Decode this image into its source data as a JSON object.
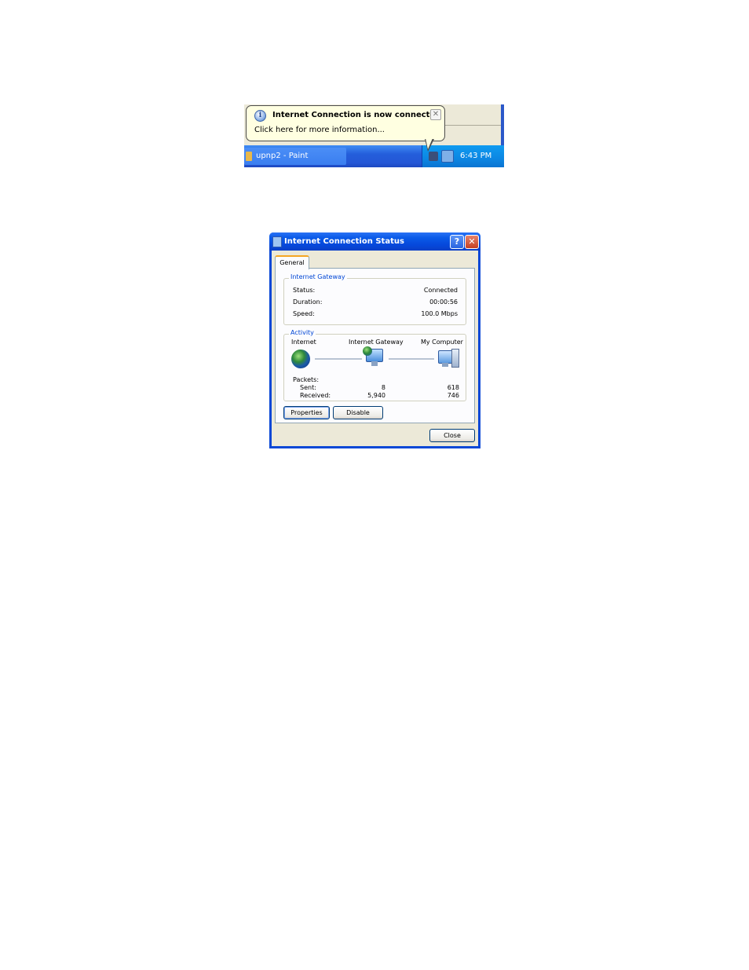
{
  "notification": {
    "title": "Internet Connection is now connected",
    "message": "Click here for more information...",
    "close_glyph": "✕",
    "icon": "info-icon"
  },
  "taskbar": {
    "task_button_label": "upnp2 - Paint",
    "clock": "6:43 PM"
  },
  "dialog": {
    "title": "Internet Connection Status",
    "help_glyph": "?",
    "close_glyph": "✕",
    "tabs": [
      {
        "label": "General"
      }
    ],
    "gateway_group": {
      "legend": "Internet Gateway",
      "rows": [
        {
          "label": "Status:",
          "value": "Connected"
        },
        {
          "label": "Duration:",
          "value": "00:00:56"
        },
        {
          "label": "Speed:",
          "value": "100.0 Mbps"
        }
      ]
    },
    "activity_group": {
      "legend": "Activity",
      "columns": [
        "Internet",
        "Internet Gateway",
        "My Computer"
      ],
      "packets_label": "Packets:",
      "sent_label": "Sent:",
      "received_label": "Received:",
      "gateway_sent": "8",
      "gateway_received": "5,940",
      "computer_sent": "618",
      "computer_received": "746"
    },
    "buttons": {
      "properties": "Properties",
      "disable": "Disable",
      "close": "Close"
    }
  },
  "colors": {
    "xp_title_blue": "#0a5ae8",
    "balloon_yellow": "#ffffe1",
    "dialog_face": "#ece9d8",
    "group_legend_blue": "#0046d5"
  }
}
